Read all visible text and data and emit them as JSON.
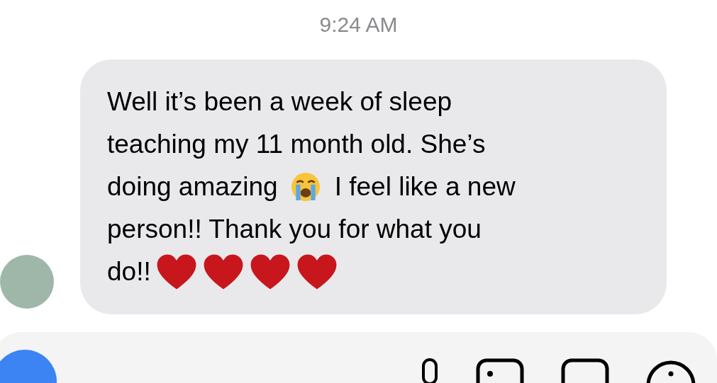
{
  "timestamp": "9:24 AM",
  "message": {
    "lines": [
      [
        {
          "kind": "text",
          "text": "Well it’s been a week of sleep"
        }
      ],
      [
        {
          "kind": "text",
          "text": "teaching my 11 month old. She’s"
        }
      ],
      [
        {
          "kind": "text",
          "text": "doing amazing"
        },
        {
          "kind": "crying-emoji"
        },
        {
          "kind": "text",
          "text": "I feel like a new"
        }
      ],
      [
        {
          "kind": "text",
          "text": "person!! Thank you for what you"
        }
      ],
      [
        {
          "kind": "text",
          "text": "do!!"
        },
        {
          "kind": "heart-emoji"
        },
        {
          "kind": "heart-emoji"
        },
        {
          "kind": "heart-emoji"
        },
        {
          "kind": "heart-emoji"
        }
      ]
    ]
  }
}
